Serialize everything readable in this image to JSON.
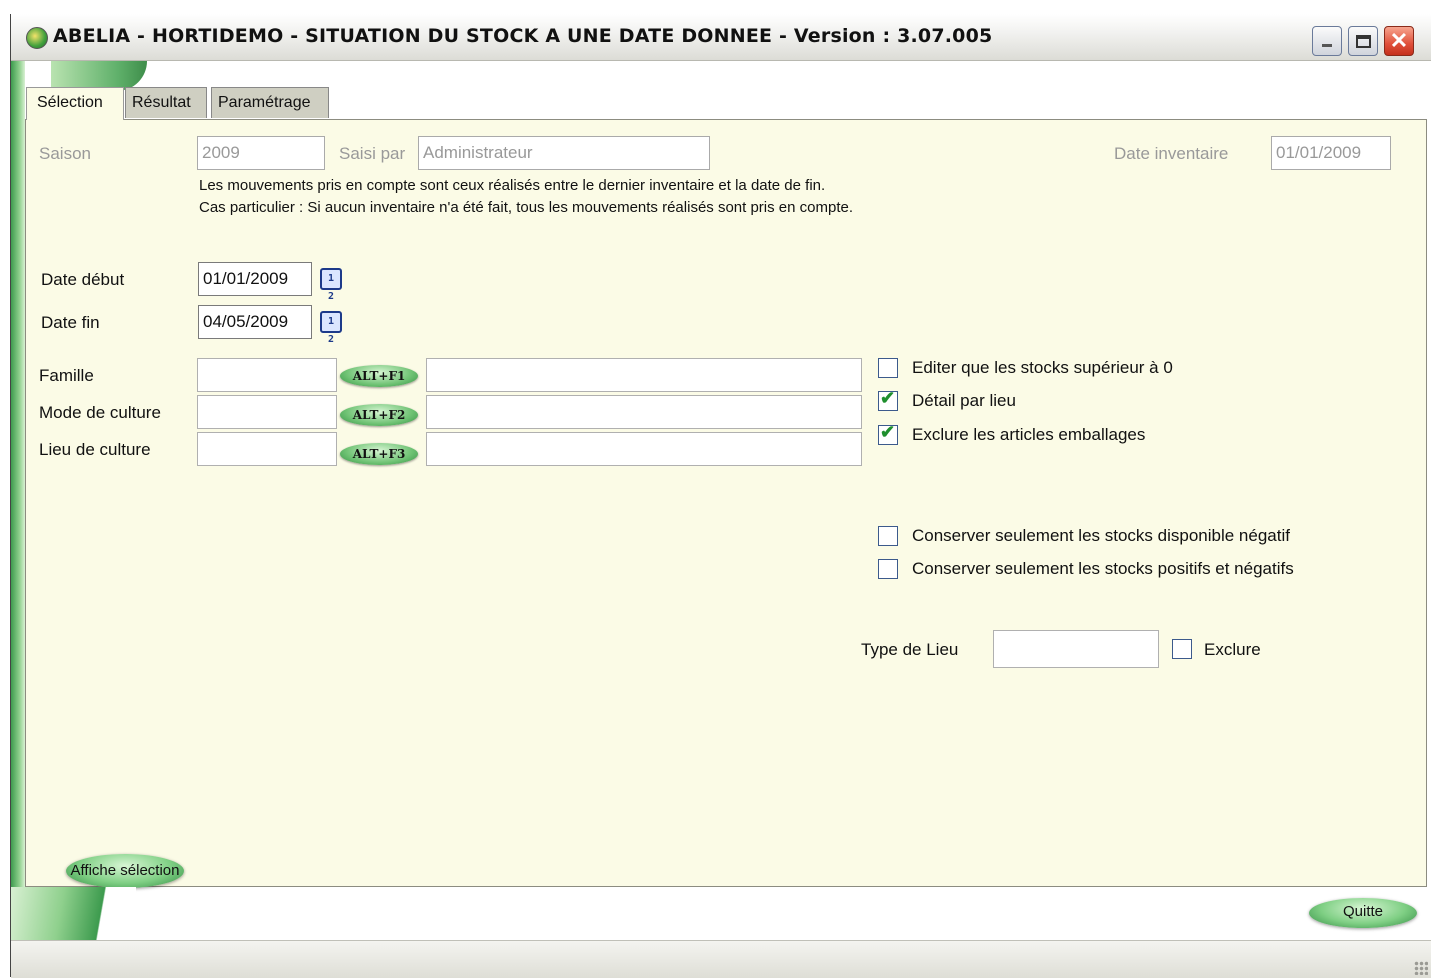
{
  "window": {
    "title": "ABELIA  -  HORTIDEMO  -  SITUATION DU STOCK A UNE DATE DONNEE  -  Version : 3.07.005",
    "minimize_glyph": "",
    "close_glyph": "✕"
  },
  "tabs": [
    {
      "label": "Sélection",
      "active": true
    },
    {
      "label": "Résultat",
      "active": false
    },
    {
      "label": "Paramétrage",
      "active": false
    }
  ],
  "header": {
    "saison_label": "Saison",
    "saison_value": "2009",
    "saisi_par_label": "Saisi par",
    "saisi_par_value": "Administrateur",
    "date_inventaire_label": "Date inventaire",
    "date_inventaire_value": "01/01/2009"
  },
  "info": {
    "line1": "Les mouvements pris en compte sont ceux réalisés entre le dernier inventaire et la date de fin.",
    "line2": "Cas particulier : Si aucun inventaire n'a été fait, tous les mouvements réalisés sont pris en compte."
  },
  "dates": {
    "debut_label": "Date début",
    "debut_value": "01/01/2009",
    "fin_label": "Date fin",
    "fin_value": "04/05/2009",
    "calendar_glyph": "1 2"
  },
  "filters": [
    {
      "label": "Famille",
      "code": "",
      "shortcut": "ALT+F1",
      "description": ""
    },
    {
      "label": "Mode de culture",
      "code": "",
      "shortcut": "ALT+F2",
      "description": ""
    },
    {
      "label": "Lieu de culture",
      "code": "",
      "shortcut": "ALT+F3",
      "description": ""
    }
  ],
  "options": [
    {
      "label": "Editer que les stocks supérieur à 0",
      "checked": false
    },
    {
      "label": "Détail par lieu",
      "checked": true
    },
    {
      "label": "Exclure les articles emballages",
      "checked": true
    },
    {
      "label": "Conserver seulement les stocks disponible négatif",
      "checked": false
    },
    {
      "label": "Conserver seulement les stocks positifs et négatifs",
      "checked": false
    }
  ],
  "type_lieu": {
    "label": "Type de Lieu",
    "value": "",
    "exclure_label": "Exclure",
    "exclure_checked": false
  },
  "buttons": {
    "affiche_selection": "Affiche sélection",
    "quitte": "Quitte"
  },
  "check_glyph": "✔"
}
